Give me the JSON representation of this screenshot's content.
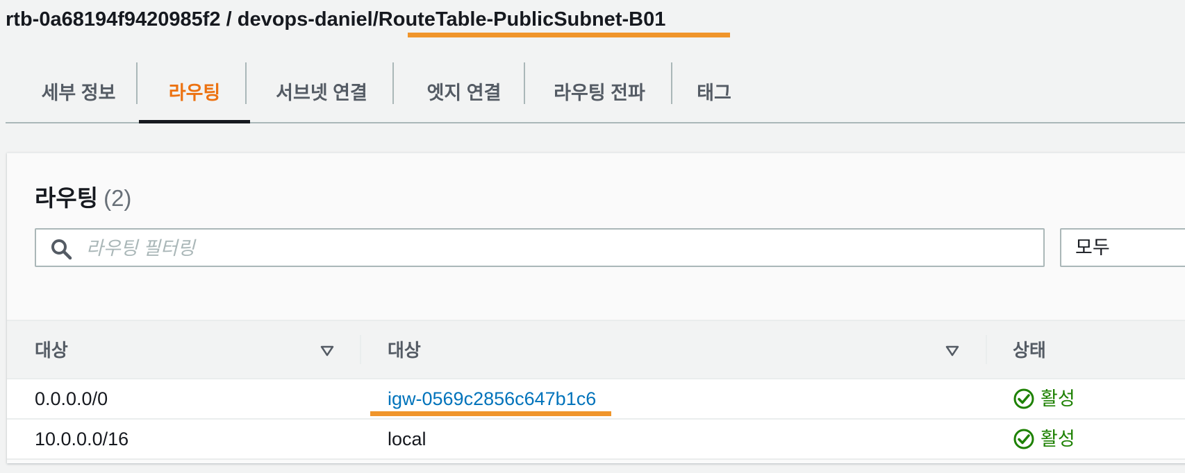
{
  "header": {
    "title_prefix": "rtb-0a68194f9420985f2 / devops-daniel/",
    "title_name": "RouteTable-PublicSubnet-B01",
    "highlight_color": "#f0952b"
  },
  "tabs": [
    {
      "label": "세부 정보",
      "active": false
    },
    {
      "label": "라우팅",
      "active": true
    },
    {
      "label": "서브넷 연결",
      "active": false
    },
    {
      "label": "엣지 연결",
      "active": false
    },
    {
      "label": "라우팅 전파",
      "active": false
    },
    {
      "label": "태그",
      "active": false
    }
  ],
  "panel": {
    "heading": "라우팅",
    "count": "(2)",
    "filter_placeholder": "라우팅 필터링",
    "filter_value": "",
    "select_value": "모두"
  },
  "table": {
    "columns": [
      "대상",
      "대상",
      "상태"
    ],
    "rows": [
      {
        "destination": "0.0.0.0/0",
        "target": "igw-0569c2856c647b1c6",
        "target_is_link": true,
        "status": "활성"
      },
      {
        "destination": "10.0.0.0/16",
        "target": "local",
        "target_is_link": false,
        "status": "활성"
      }
    ]
  },
  "colors": {
    "active_tab": "#ec7211",
    "link": "#0073bb",
    "status_ok": "#1d8102",
    "highlight": "#f0952b"
  },
  "icons": {
    "search": "search-icon",
    "sort": "sort-down-icon",
    "status": "check-circle-icon"
  }
}
